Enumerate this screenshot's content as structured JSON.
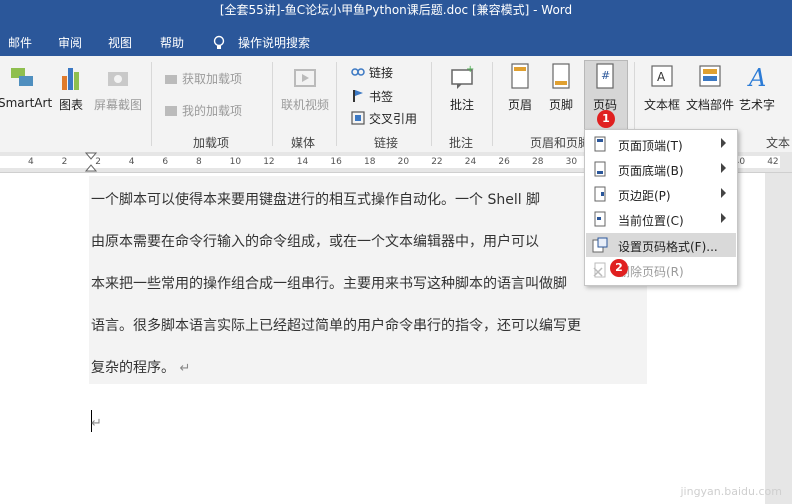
{
  "window": {
    "title": "[全套55讲]-鱼C论坛小甲鱼Python课后题.doc [兼容模式]  -  Word"
  },
  "menubar": {
    "items": [
      "邮件",
      "审阅",
      "视图",
      "帮助",
      "操作说明搜索"
    ]
  },
  "ribbon": {
    "smartart": "SmartArt",
    "chart": "图表",
    "screenshot": "屏幕截图",
    "get_addins": "获取加载项",
    "my_addins": "我的加载项",
    "group_addins": "加载项",
    "online_video": "联机视频",
    "group_media": "媒体",
    "link": "链接",
    "bookmark": "书签",
    "cross_ref": "交叉引用",
    "group_links": "链接",
    "comment": "批注",
    "group_comments": "批注",
    "header": "页眉",
    "footer": "页脚",
    "page_number": "页码",
    "group_header_footer": "页眉和页脚",
    "textbox": "文本框",
    "quick_parts": "文档部件",
    "wordart": "艺术字",
    "group_text": "文本"
  },
  "ruler": {
    "numbers": [
      "4",
      "2",
      "2",
      "4",
      "6",
      "8",
      "10",
      "12",
      "14",
      "16",
      "18",
      "20",
      "22",
      "24",
      "26",
      "28",
      "30",
      "32",
      "34",
      "36",
      "38",
      "40",
      "42"
    ]
  },
  "document": {
    "lines": [
      "一个脚本可以使得本来要用键盘进行的相互式操作自动化。一个 Shell 脚",
      "由原本需要在命令行输入的命令组成，或在一个文本编辑器中，用户可以",
      "本来把一些常用的操作组合成一组串行。主要用来书写这种脚本的语言叫做脚",
      "语言。很多脚本语言实际上已经超过简单的用户命令串行的指令，还可以编写更",
      "复杂的程序。"
    ],
    "return_mark": "↵"
  },
  "dropdown": {
    "items": [
      {
        "label": "页面顶端(T)",
        "submenu": true
      },
      {
        "label": "页面底端(B)",
        "submenu": true
      },
      {
        "label": "页边距(P)",
        "submenu": true
      },
      {
        "label": "当前位置(C)",
        "submenu": true
      },
      {
        "label": "设置页码格式(F)...",
        "submenu": false
      },
      {
        "label": "删除页码(R)",
        "submenu": false
      }
    ]
  },
  "badges": {
    "first": "1",
    "second": "2"
  },
  "watermark": "jingyan.baidu.com",
  "colors": {
    "accent": "#2b579a",
    "badge": "#e02020",
    "highlight": "#d9d9d9"
  }
}
